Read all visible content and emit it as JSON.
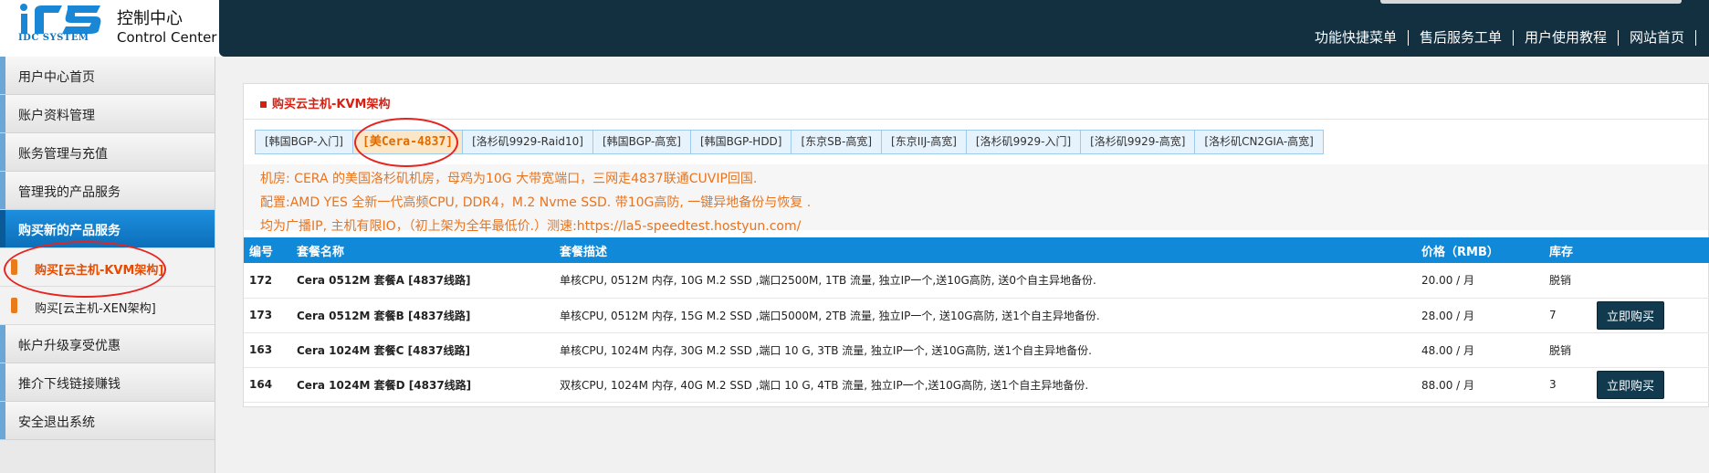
{
  "logo": {
    "title": "控制中心",
    "subtitle": "Control Center",
    "brand": "IDC SYSTEM"
  },
  "topnav": [
    "功能快捷菜单",
    "售后服务工单",
    "用户使用教程",
    "网站首页"
  ],
  "sidebar": {
    "items": [
      {
        "label": "用户中心首页"
      },
      {
        "label": "账户资料管理"
      },
      {
        "label": "账务管理与充值"
      },
      {
        "label": "管理我的产品服务"
      },
      {
        "label": "购买新的产品服务"
      }
    ],
    "subitems": [
      {
        "label": "购买[云主机-KVM架构]"
      },
      {
        "label": "购买[云主机-XEN架构]"
      }
    ],
    "bottom_items": [
      {
        "label": "帐户升级享受优惠"
      },
      {
        "label": "推介下线链接赚钱"
      },
      {
        "label": "安全退出系统"
      }
    ]
  },
  "panel": {
    "title": "购买云主机-KVM架构",
    "tabs": [
      "[韩国BGP-入门]",
      "[美Cera-4837]",
      "[洛杉矶9929-Raid10]",
      "[韩国BGP-高宽]",
      "[韩国BGP-HDD]",
      "[东京SB-高宽]",
      "[东京IIJ-高宽]",
      "[洛杉矶9929-入门]",
      "[洛杉矶9929-高宽]",
      "[洛杉矶CN2GIA-高宽]"
    ],
    "info": [
      "机房: CERA 的美国洛杉矶机房，母鸡为10G 大带宽端口，三网走4837联通CUVIP回国.",
      "配置:AMD YES 全新一代高频CPU, DDR4，M.2 Nvme SSD. 带10G高防, 一键异地备份与恢复 .",
      "均为广播IP, 主机有限IO，（初上架为全年最低价.）测速:https://la5-speedtest.hostyun.com/"
    ]
  },
  "table": {
    "headers": [
      "编号",
      "套餐名称",
      "套餐描述",
      "价格（RMB）",
      "库存",
      ""
    ],
    "rows": [
      {
        "id": "172",
        "name": "Cera 0512M 套餐A [4837线路]",
        "desc": "单核CPU, 0512M 内存, 10G M.2 SSD ,端口2500M, 1TB 流量, 独立IP一个,送10G高防, 送0个自主异地备份.",
        "price": "20.00 / 月",
        "stock": "脱销",
        "button": ""
      },
      {
        "id": "173",
        "name": "Cera 0512M 套餐B [4837线路]",
        "desc": "单核CPU, 0512M 内存, 15G M.2 SSD ,端口5000M, 2TB 流量, 独立IP一个, 送10G高防, 送1个自主异地备份.",
        "price": "28.00 / 月",
        "stock": "7",
        "button": "立即购买"
      },
      {
        "id": "163",
        "name": "Cera 1024M 套餐C [4837线路]",
        "desc": "单核CPU, 1024M 内存, 30G M.2 SSD ,端口 10 G, 3TB 流量, 独立IP一个, 送10G高防, 送1个自主异地备份.",
        "price": "48.00 / 月",
        "stock": "脱销",
        "button": ""
      },
      {
        "id": "164",
        "name": "Cera 1024M 套餐D [4837线路]",
        "desc": "双核CPU, 1024M 内存, 40G M.2 SSD ,端口 10 G, 4TB 流量, 独立IP一个,送10G高防, 送1个自主异地备份.",
        "price": "88.00 / 月",
        "stock": "3",
        "button": "立即购买"
      }
    ]
  },
  "colors": {
    "header": "#123040",
    "accent": "#1089d8",
    "alert": "#e8741f",
    "title": "#d71f12"
  }
}
